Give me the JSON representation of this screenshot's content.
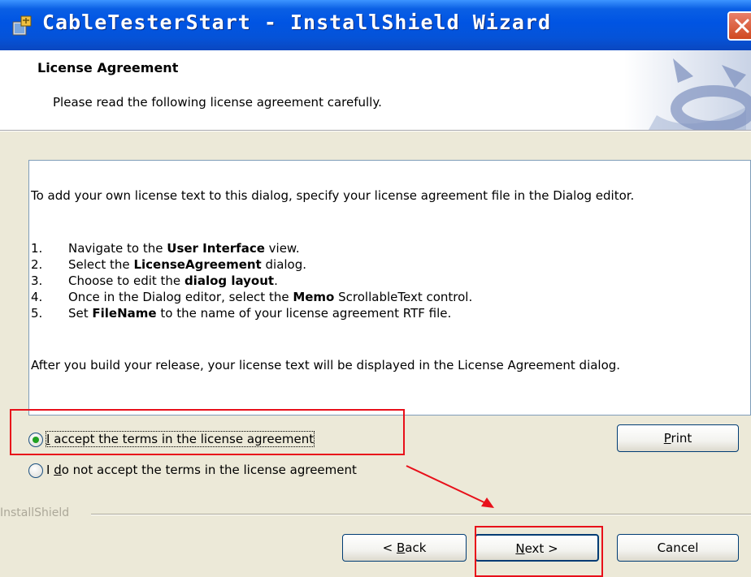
{
  "window": {
    "title": "CableTesterStart - InstallShield Wizard",
    "close_icon": "close-icon"
  },
  "header": {
    "title": "License Agreement",
    "subtitle": "Please read the following license agreement carefully."
  },
  "license": {
    "intro": "To add your own license text to this dialog, specify your license agreement file in the Dialog editor.",
    "steps": [
      {
        "num": "1.",
        "pre": "Navigate to the ",
        "bold": "User Interface",
        "post": " view."
      },
      {
        "num": "2.",
        "pre": "Select the ",
        "bold": "LicenseAgreement",
        "post": " dialog."
      },
      {
        "num": "3.",
        "pre": "Choose to edit the ",
        "bold": "dialog layout",
        "post": "."
      },
      {
        "num": "4.",
        "pre": "Once in the Dialog editor, select the ",
        "bold": "Memo",
        "post": " ScrollableText control."
      },
      {
        "num": "5.",
        "pre": "Set ",
        "bold": "FileName",
        "post": " to the name of your license agreement RTF file."
      }
    ],
    "footer": "After you build your release, your license text will be displayed in the License Agreement dialog."
  },
  "options": {
    "accept": {
      "mnemonic": "I",
      "rest": " accept the terms in the license agreement",
      "selected": true
    },
    "decline": {
      "pre": "I ",
      "mnemonic": "d",
      "rest": "o not accept the terms in the license agreement",
      "selected": false
    }
  },
  "buttons": {
    "print": {
      "mnemonic": "P",
      "rest": "rint"
    },
    "back": {
      "pre": "< ",
      "mnemonic": "B",
      "rest": "ack"
    },
    "next": {
      "mnemonic": "N",
      "rest": "ext >"
    },
    "cancel": {
      "label": "Cancel"
    }
  },
  "brand": "InstallShield",
  "colors": {
    "titlebar": "#0054e3",
    "dialog_bg": "#ece9d8",
    "annotation_red": "#e8101a",
    "radio_selected": "#21a121"
  }
}
